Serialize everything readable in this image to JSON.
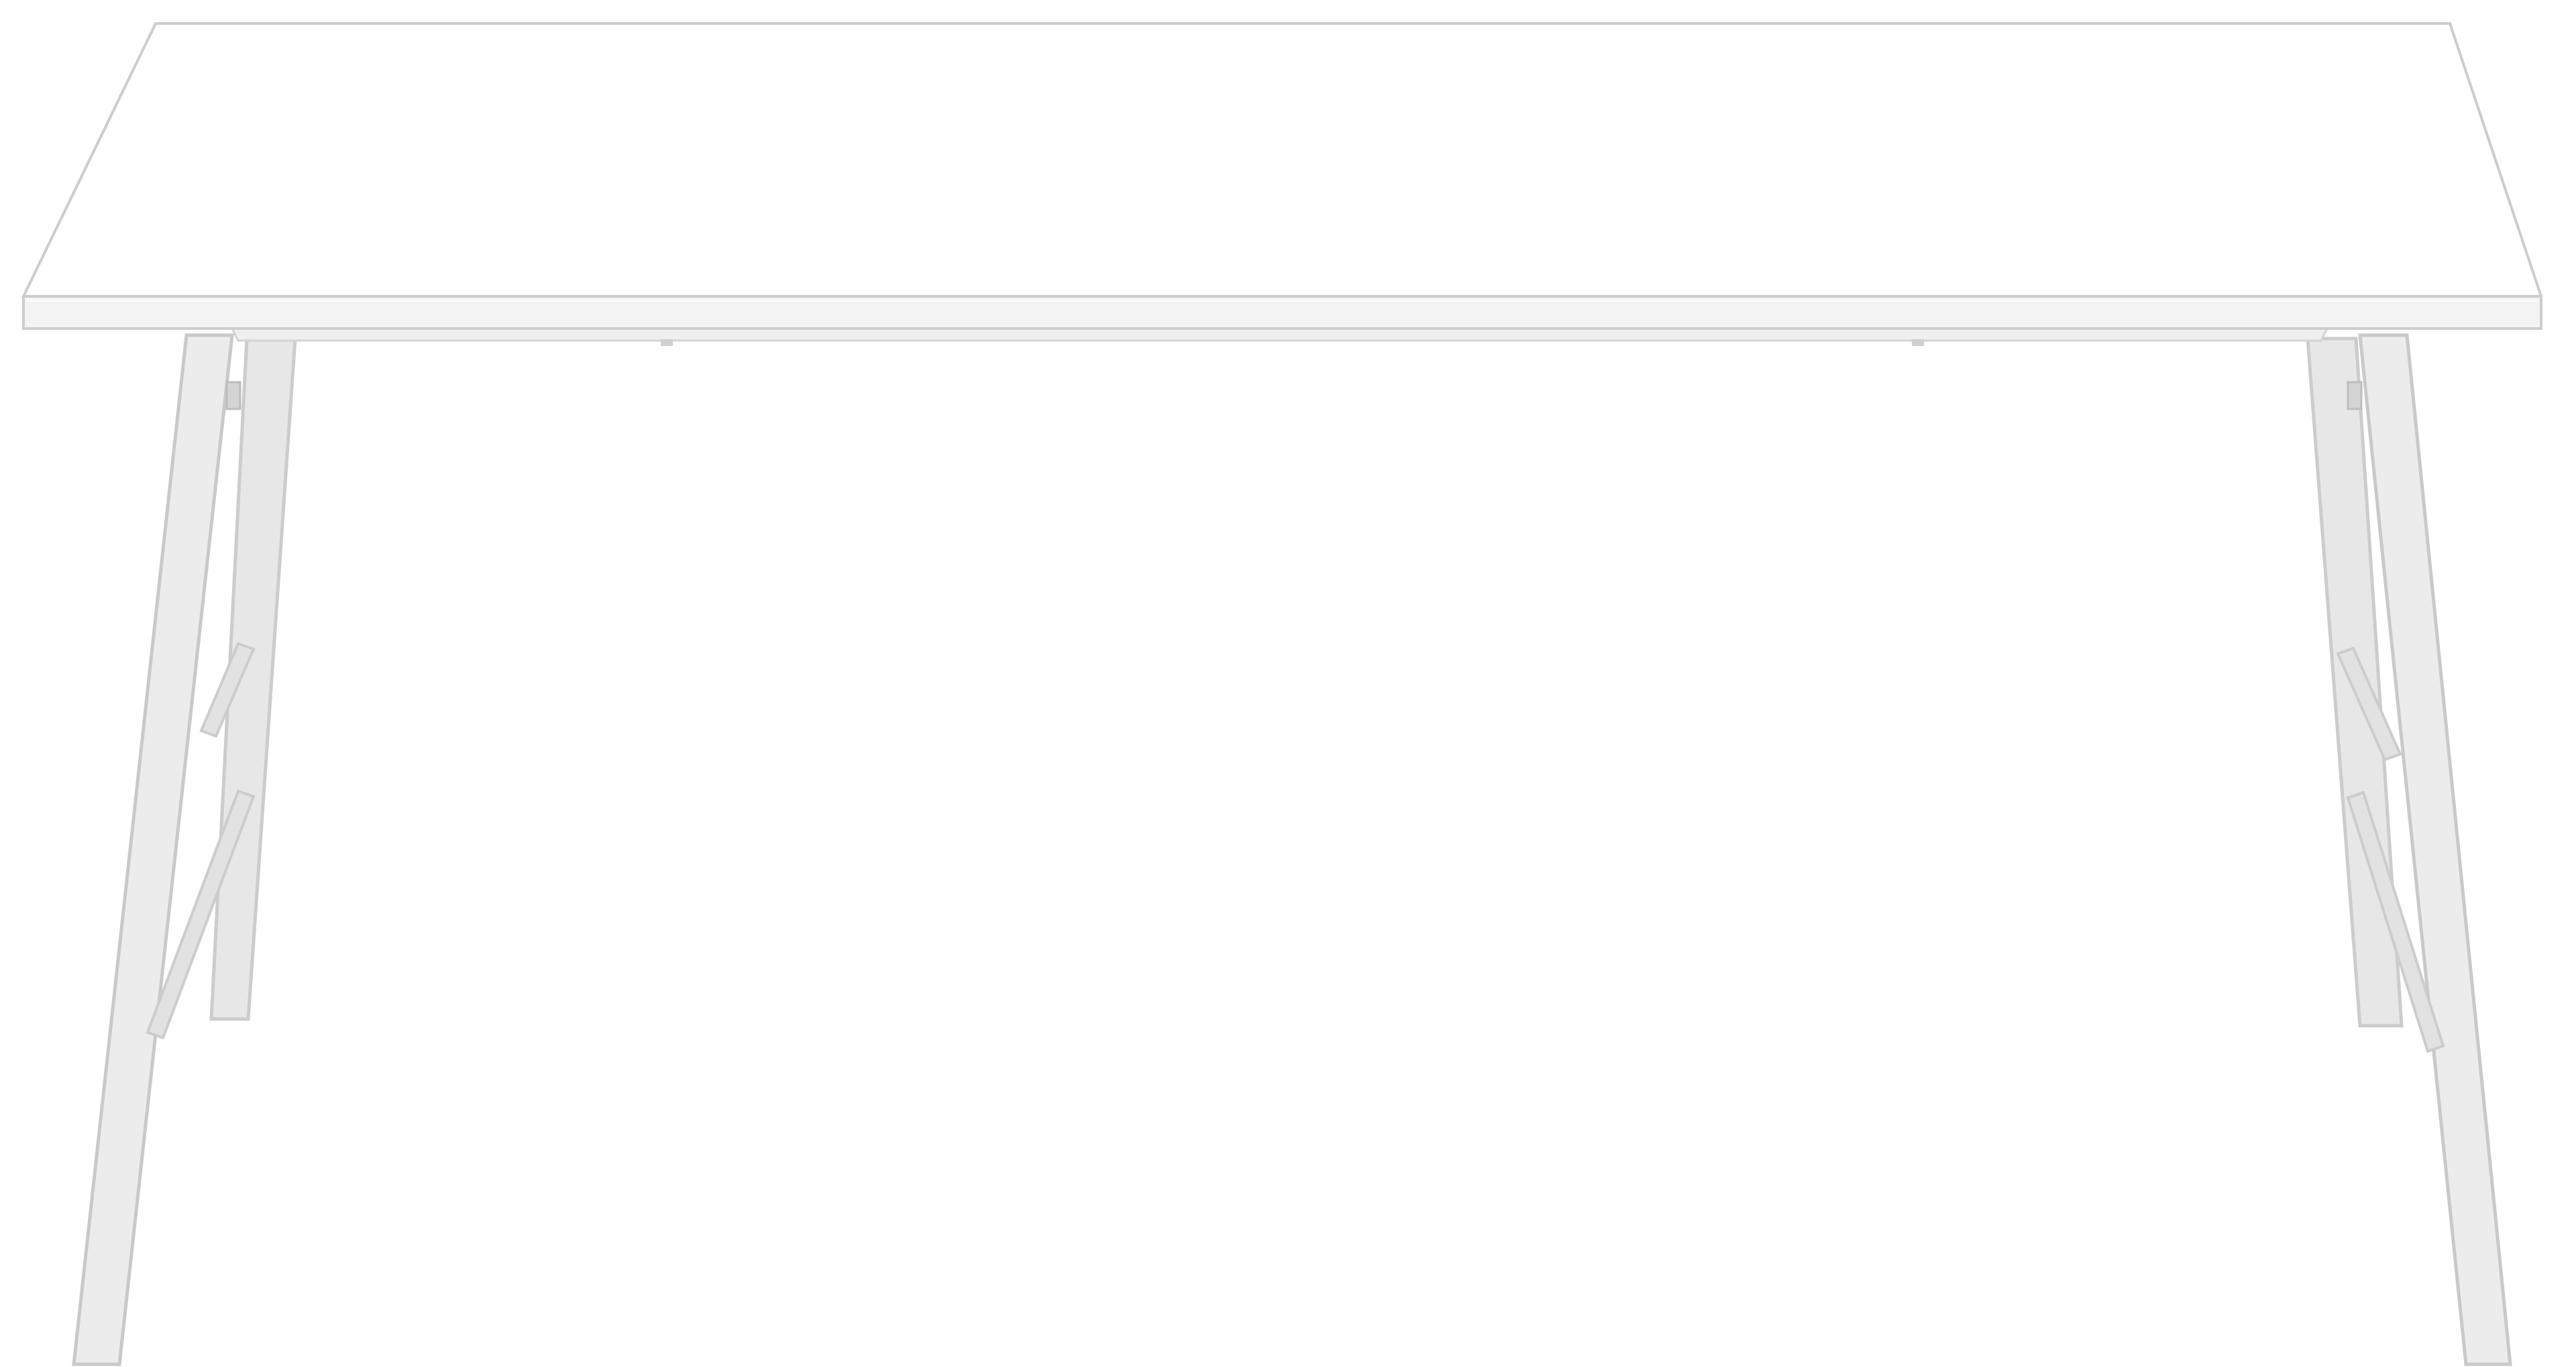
{
  "image": {
    "subject": "white-table",
    "colors": {
      "background": "#ffffff",
      "tabletop_surface": "#ffffff",
      "tabletop_edge": "#f1f1f1",
      "outline": "#cfcfcf",
      "leg": "#e9e9e9",
      "leg_shade": "#d9d9d9"
    }
  }
}
